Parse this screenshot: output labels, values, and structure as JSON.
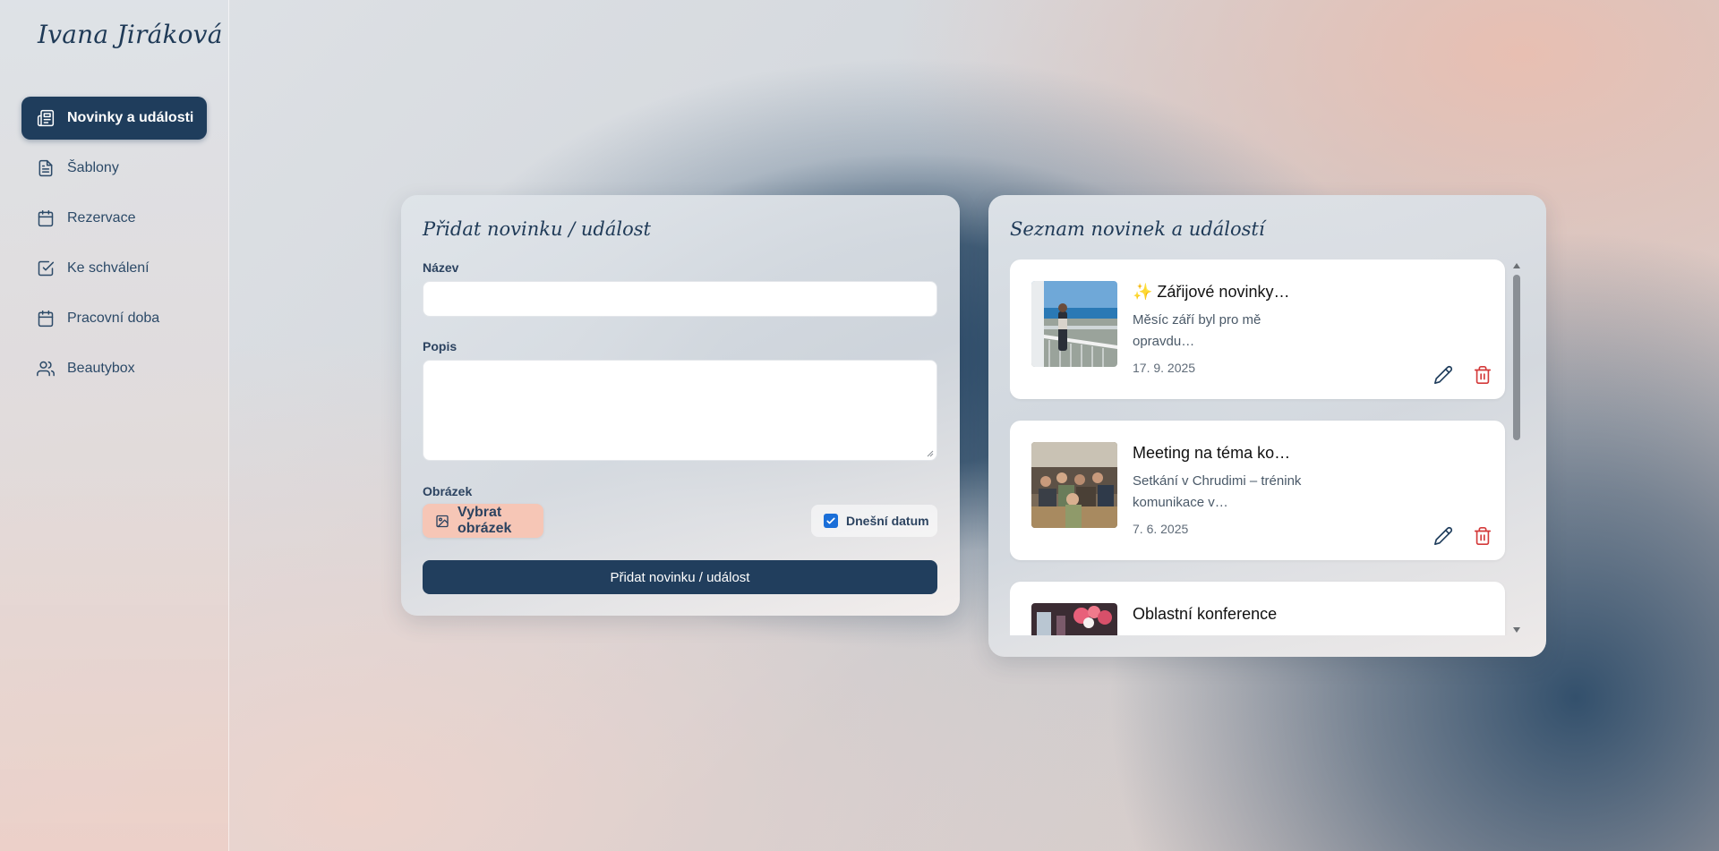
{
  "sidebar": {
    "brand": "Ivana Jiráková",
    "items": [
      {
        "label": "Novinky a události",
        "icon": "newspaper-icon",
        "active": true
      },
      {
        "label": "Šablony",
        "icon": "document-icon",
        "active": false
      },
      {
        "label": "Rezervace",
        "icon": "calendar-icon",
        "active": false
      },
      {
        "label": "Ke schválení",
        "icon": "check-square-icon",
        "active": false
      },
      {
        "label": "Pracovní doba",
        "icon": "calendar-icon",
        "active": false
      },
      {
        "label": "Beautybox",
        "icon": "users-icon",
        "active": false
      }
    ]
  },
  "form": {
    "title": "Přidat novinku / událost",
    "name_label": "Název",
    "name_value": "",
    "desc_label": "Popis",
    "desc_value": "",
    "image_label": "Obrázek",
    "image_button": "Vybrat obrázek",
    "today_label": "Dnešní datum",
    "today_checked": true,
    "submit_label": "Přidat novinku / událost"
  },
  "list": {
    "title": "Seznam novinek a událostí",
    "items": [
      {
        "title": "✨ Zářijové novinky…",
        "desc": "Měsíc září byl pro mě opravdu…",
        "date": "17. 9. 2025"
      },
      {
        "title": "Meeting na téma ko…",
        "desc": "Setkání v Chrudimi – trénink komunikace v…",
        "date": "7. 6. 2025"
      },
      {
        "title": "Oblastní konference",
        "desc": "",
        "date": ""
      }
    ]
  },
  "colors": {
    "primary": "#1f3d5c",
    "accent": "#f6c6b6",
    "danger": "#d43a3a",
    "checkbox": "#1a6ed8"
  }
}
